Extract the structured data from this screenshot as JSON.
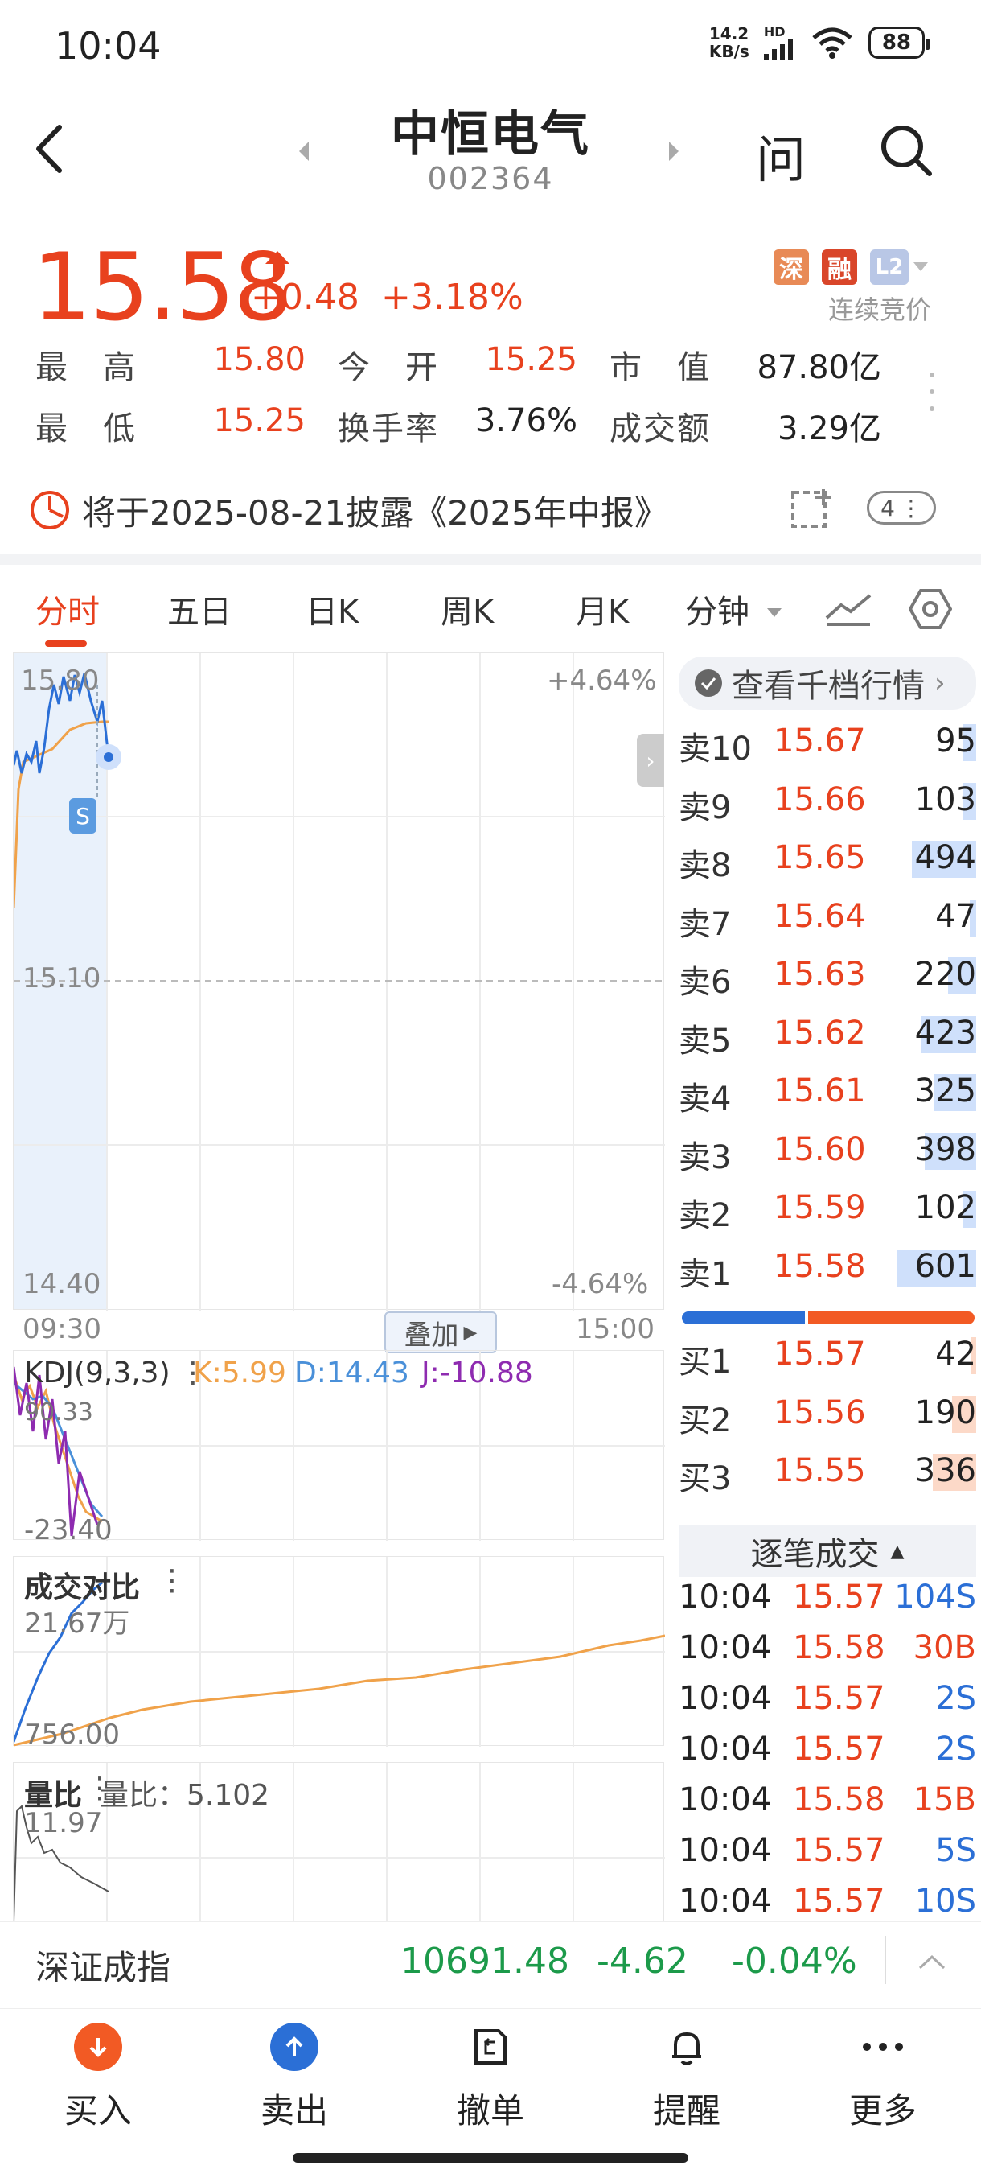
{
  "status_bar": {
    "time": "10:04",
    "net_speed_value": "14.2",
    "net_speed_unit": "KB/s",
    "network": "HD",
    "battery": "88"
  },
  "header": {
    "title": "中恒电气",
    "code": "002364",
    "ask_label": "问"
  },
  "quote": {
    "price": "15.58",
    "change": "+0.48",
    "change_pct": "+3.18%",
    "tags": [
      "深",
      "融",
      "L2"
    ],
    "trading_status": "连续竞价",
    "stats": [
      {
        "label": "最　高",
        "value": "15.80",
        "color": "red"
      },
      {
        "label": "今　开",
        "value": "15.25",
        "color": "red"
      },
      {
        "label": "市　值",
        "value": "87.80亿",
        "color": "black"
      },
      {
        "label": "最　低",
        "value": "15.25",
        "color": "red"
      },
      {
        "label": "换手率",
        "value": "3.76%",
        "color": "black"
      },
      {
        "label": "成交额",
        "value": "3.29亿",
        "color": "black"
      }
    ]
  },
  "announcement": {
    "text": "将于2025-08-21披露《2025年中报》",
    "badge": "4"
  },
  "tabs": [
    "分时",
    "五日",
    "日K",
    "周K",
    "月K",
    "分钟"
  ],
  "active_tab": "分时",
  "chart": {
    "y_top": "15.80",
    "y_mid": "15.10",
    "y_bottom": "14.40",
    "pct_top": "+4.64%",
    "pct_bottom": "-4.64%",
    "time_start": "09:30",
    "time_end": "15:00",
    "overlay_label": "叠加",
    "s_marker": "S"
  },
  "kdj": {
    "title": "KDJ(9,3,3)",
    "k": "K:5.99",
    "d": "D:14.43",
    "j": "J:-10.88",
    "y_top": "90.33",
    "y_bottom": "-23.40"
  },
  "volume_compare": {
    "title": "成交对比",
    "top": "21.67万",
    "bottom": "756.00"
  },
  "volume_ratio": {
    "title": "量比",
    "label": "量比：5.102",
    "top": "11.97"
  },
  "order_book": {
    "depth_button": "查看千档行情",
    "sells": [
      {
        "label": "卖10",
        "price": "15.67",
        "volume": "95",
        "fill": 0.1
      },
      {
        "label": "卖9",
        "price": "15.66",
        "volume": "103",
        "fill": 0.1
      },
      {
        "label": "卖8",
        "price": "15.65",
        "volume": "494",
        "fill": 0.5
      },
      {
        "label": "卖7",
        "price": "15.64",
        "volume": "47",
        "fill": 0.05
      },
      {
        "label": "卖6",
        "price": "15.63",
        "volume": "220",
        "fill": 0.22
      },
      {
        "label": "卖5",
        "price": "15.62",
        "volume": "423",
        "fill": 0.43
      },
      {
        "label": "卖4",
        "price": "15.61",
        "volume": "325",
        "fill": 0.33
      },
      {
        "label": "卖3",
        "price": "15.60",
        "volume": "398",
        "fill": 0.4
      },
      {
        "label": "卖2",
        "price": "15.59",
        "volume": "102",
        "fill": 0.1
      },
      {
        "label": "卖1",
        "price": "15.58",
        "volume": "601",
        "fill": 0.61
      }
    ],
    "buys": [
      {
        "label": "买1",
        "price": "15.57",
        "volume": "42",
        "fill": 0.04
      },
      {
        "label": "买2",
        "price": "15.56",
        "volume": "190",
        "fill": 0.19
      },
      {
        "label": "买3",
        "price": "15.55",
        "volume": "336",
        "fill": 0.34
      }
    ],
    "balance": {
      "sell": 0.42,
      "buy": 0.58
    }
  },
  "trades": {
    "title": "逐笔成交",
    "rows": [
      {
        "time": "10:04",
        "price": "15.57",
        "volume": "104S",
        "side": "S"
      },
      {
        "time": "10:04",
        "price": "15.58",
        "volume": "30B",
        "side": "B"
      },
      {
        "time": "10:04",
        "price": "15.57",
        "volume": "2S",
        "side": "S"
      },
      {
        "time": "10:04",
        "price": "15.57",
        "volume": "2S",
        "side": "S"
      },
      {
        "time": "10:04",
        "price": "15.58",
        "volume": "15B",
        "side": "B"
      },
      {
        "time": "10:04",
        "price": "15.57",
        "volume": "5S",
        "side": "S"
      },
      {
        "time": "10:04",
        "price": "15.57",
        "volume": "10S",
        "side": "S"
      }
    ]
  },
  "index": {
    "name": "深证成指",
    "value": "10691.48",
    "change": "-4.62",
    "change_pct": "-0.04%"
  },
  "bottom_nav": [
    "买入",
    "卖出",
    "撤单",
    "提醒",
    "更多"
  ],
  "colors": {
    "up": "#e8411e",
    "down": "#1c9a4a",
    "sell_bar": "#cfe0fb",
    "buy_bar": "#fcd9c8",
    "accent_blue": "#2b6fd6"
  }
}
